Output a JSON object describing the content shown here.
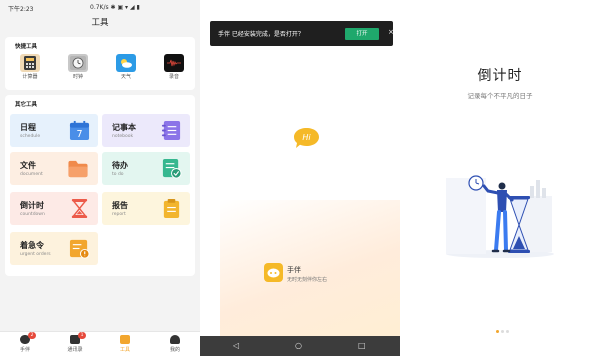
{
  "status_bar": {
    "time": "下午2:23",
    "network": "0.7K/s ✱ ▣ ▾ ◢ ▮"
  },
  "tools_page": {
    "title": "工具",
    "quick_tools": {
      "title": "快捷工具",
      "items": [
        {
          "label": "计算器",
          "icon": "calculator-icon"
        },
        {
          "label": "时钟",
          "icon": "clock-icon"
        },
        {
          "label": "天气",
          "icon": "weather-icon"
        },
        {
          "label": "录音",
          "icon": "recorder-icon"
        }
      ]
    },
    "other_tools": {
      "title": "其它工具",
      "items": [
        {
          "name": "日程",
          "sub": "schedule",
          "icon": "calendar-icon",
          "value": "7",
          "bg": "#e6f1fc",
          "accent": "#4a8ee8"
        },
        {
          "name": "记事本",
          "sub": "notebook",
          "icon": "notebook-icon",
          "bg": "#ece9fb",
          "accent": "#8b74e8"
        },
        {
          "name": "文件",
          "sub": "document",
          "icon": "folder-icon",
          "bg": "#fdeee2",
          "accent": "#f08a4b"
        },
        {
          "name": "待办",
          "sub": "to do",
          "icon": "todo-icon",
          "bg": "#e3f6f0",
          "accent": "#36b78f"
        },
        {
          "name": "倒计时",
          "sub": "countdown",
          "icon": "hourglass-icon",
          "bg": "#fdeae6",
          "accent": "#ec5b4a"
        },
        {
          "name": "报告",
          "sub": "report",
          "icon": "report-icon",
          "bg": "#fdf5dd",
          "accent": "#f2b52e"
        },
        {
          "name": "着急令",
          "sub": "urgent orders",
          "icon": "urgent-icon",
          "bg": "#fdf2dd",
          "accent": "#f2a62e"
        }
      ]
    },
    "tabs": [
      {
        "label": "手伴",
        "badge": "2"
      },
      {
        "label": "通讯录",
        "badge": "1"
      },
      {
        "label": "工具",
        "active": true
      },
      {
        "label": "我的"
      }
    ],
    "accent": "#f2a62e"
  },
  "splash": {
    "toast_text": "手伴 已经安装完成，是否打开？",
    "toast_button": "打开",
    "toast_close": "×",
    "hi_text": "Hi",
    "brand_name": "手伴",
    "brand_slogan": "无时无刻伴你左右",
    "nav": {
      "back": "◁",
      "home": "○",
      "recent": "□"
    }
  },
  "countdown": {
    "title": "倒计时",
    "subtitle": "记录每个不平凡的日子"
  }
}
